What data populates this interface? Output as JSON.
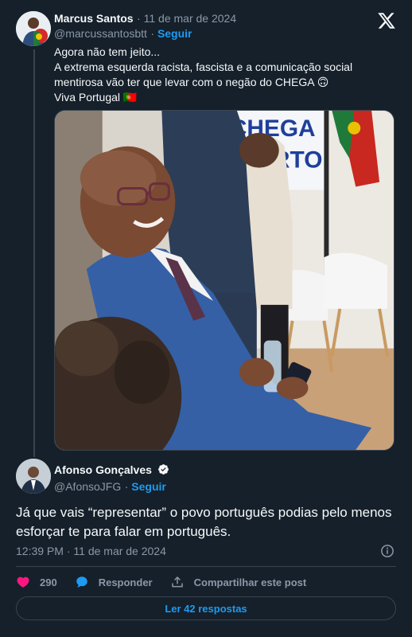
{
  "original_post": {
    "author_name": "Marcus Santos",
    "timestamp": "11 de mar de 2024",
    "handle": "@marcussantosbtt",
    "follow_label": "Seguir",
    "text_lines": [
      "Agora não tem jeito...",
      "A extrema esquerda racista, fascista e a comunicação social",
      "mentirosa vão ter que levar com o negão do CHEGA 🙃",
      "Viva Portugal 🇵🇹"
    ],
    "image_sign_text": [
      "CHEGA",
      "PORTO"
    ]
  },
  "reply": {
    "author_name": "Afonso Gonçalves",
    "handle": "@AfonsoJFG",
    "follow_label": "Seguir",
    "text": "Já que vais “representar” o povo português podias pelo menos esforçar te para falar em português.",
    "time": "12:39 PM",
    "date": "11 de mar de 2024"
  },
  "actions": {
    "like_count": "290",
    "reply_label": "Responder",
    "share_label": "Compartilhar este post"
  },
  "read_replies_label": "Ler 42 respostas",
  "colors": {
    "background": "#15202b",
    "accent": "#1d9bf0",
    "like": "#f91880",
    "muted": "#8b98a5",
    "border": "#38444d"
  },
  "icons": [
    "x-logo-icon",
    "verified-badge-icon",
    "info-icon",
    "heart-icon",
    "reply-bubble-icon",
    "share-icon"
  ]
}
